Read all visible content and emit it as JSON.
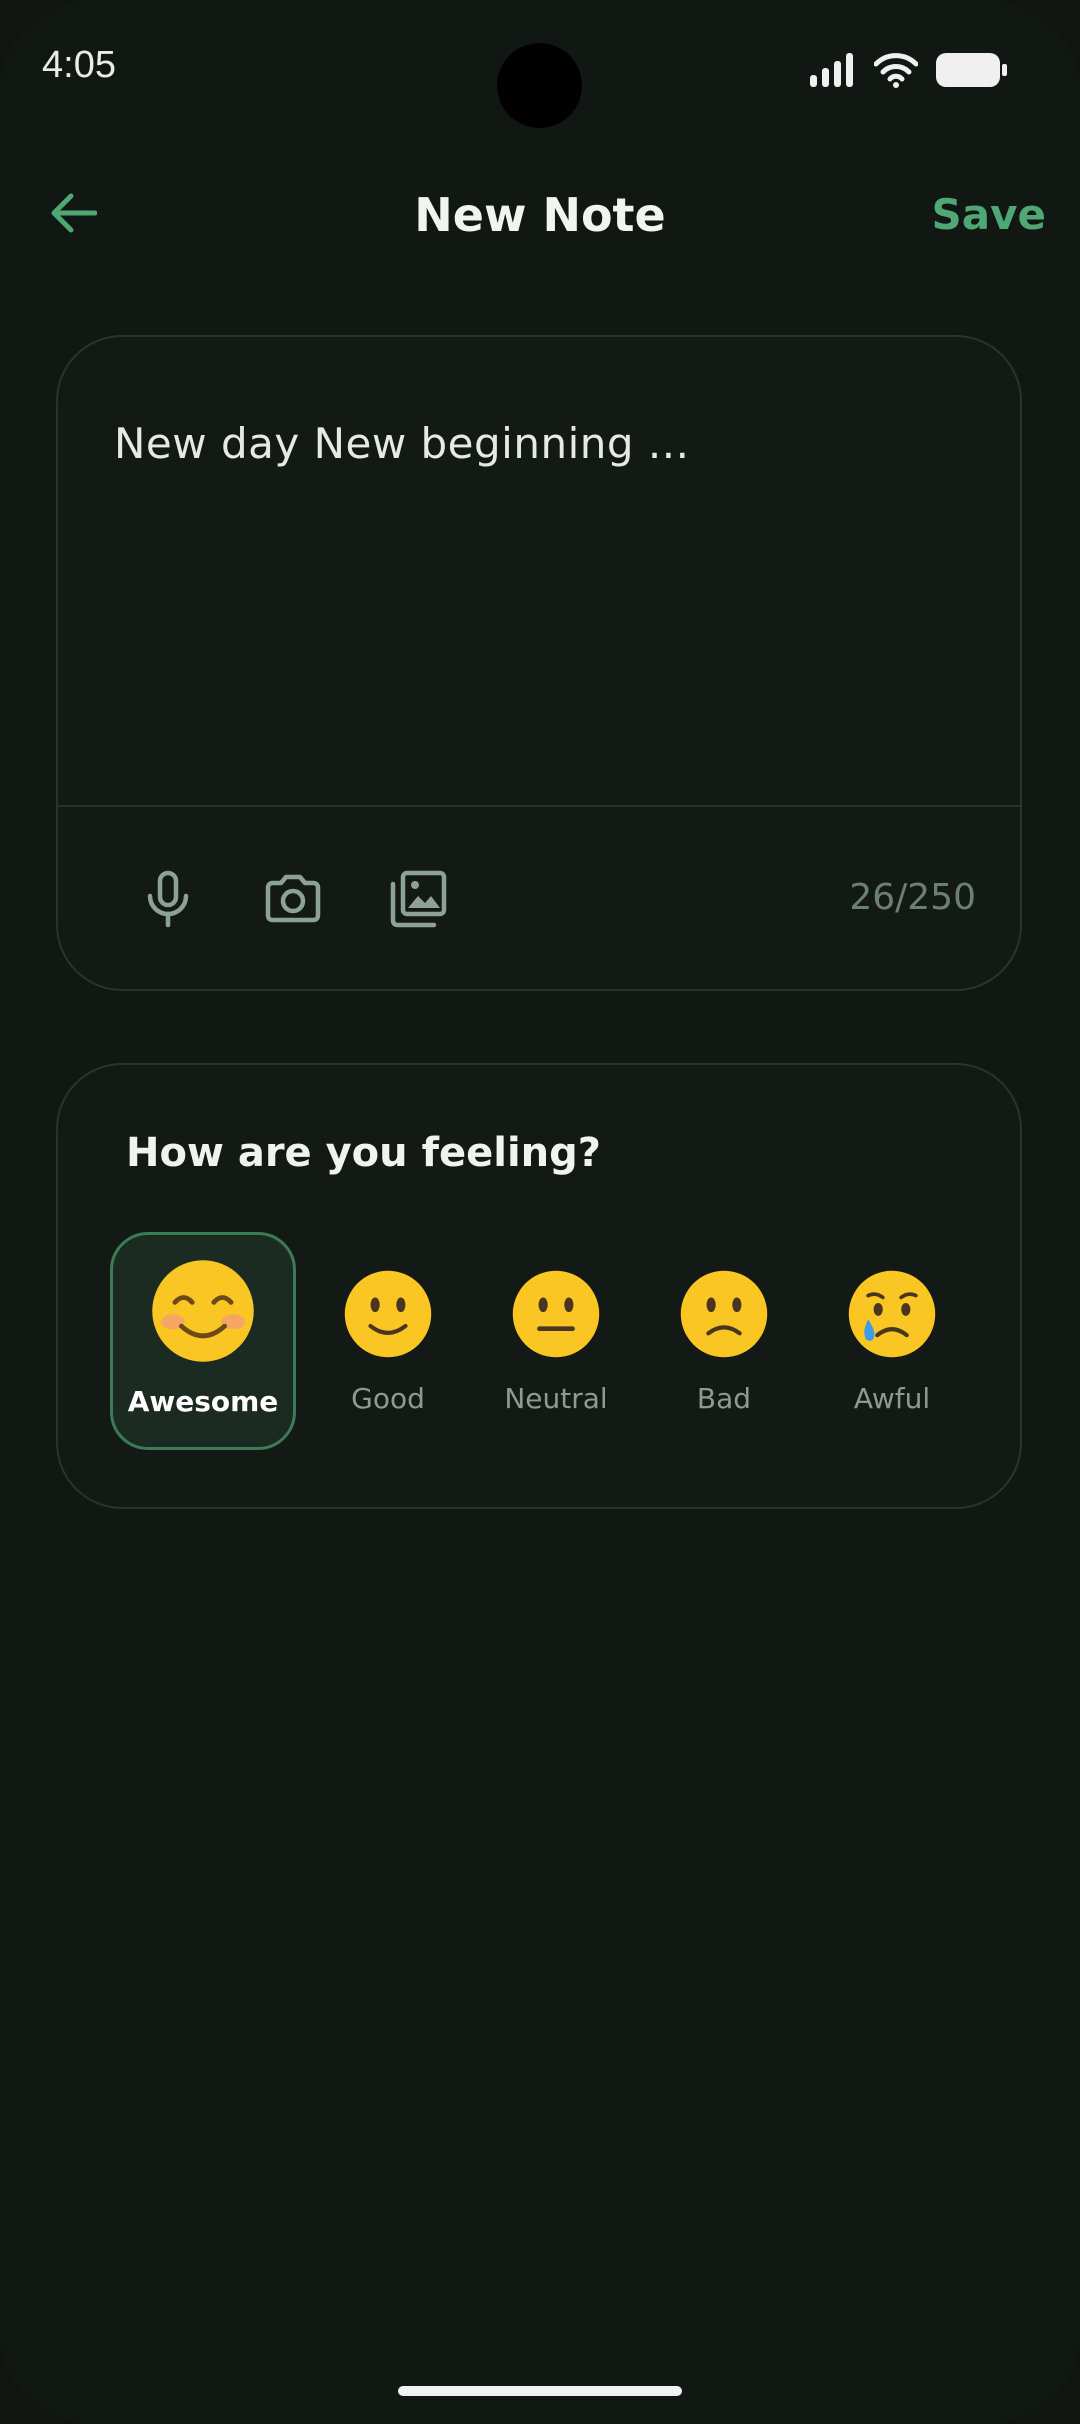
{
  "status_bar": {
    "time": "4:05"
  },
  "header": {
    "title": "New Note",
    "save_label": "Save",
    "back_icon": "arrow-left-icon"
  },
  "note": {
    "text": "New day New beginning ...",
    "char_count": "26/250",
    "tools": [
      "microphone-icon",
      "camera-icon",
      "gallery-icon"
    ]
  },
  "mood": {
    "title": "How are you feeling?",
    "selected": "Awesome",
    "options": [
      {
        "label": "Awesome",
        "emoji": "smiling-face-with-blush"
      },
      {
        "label": "Good",
        "emoji": "slightly-smiling-face"
      },
      {
        "label": "Neutral",
        "emoji": "neutral-face"
      },
      {
        "label": "Bad",
        "emoji": "slightly-frowning-face"
      },
      {
        "label": "Awful",
        "emoji": "crying-face"
      }
    ]
  },
  "colors": {
    "background": "#111713",
    "accent": "#4fa774",
    "card": "#131a16",
    "card_border": "#27352c",
    "selected_bg": "#1c2b22",
    "selected_border": "#3d7a56",
    "emoji_yellow": "#f9c623"
  }
}
